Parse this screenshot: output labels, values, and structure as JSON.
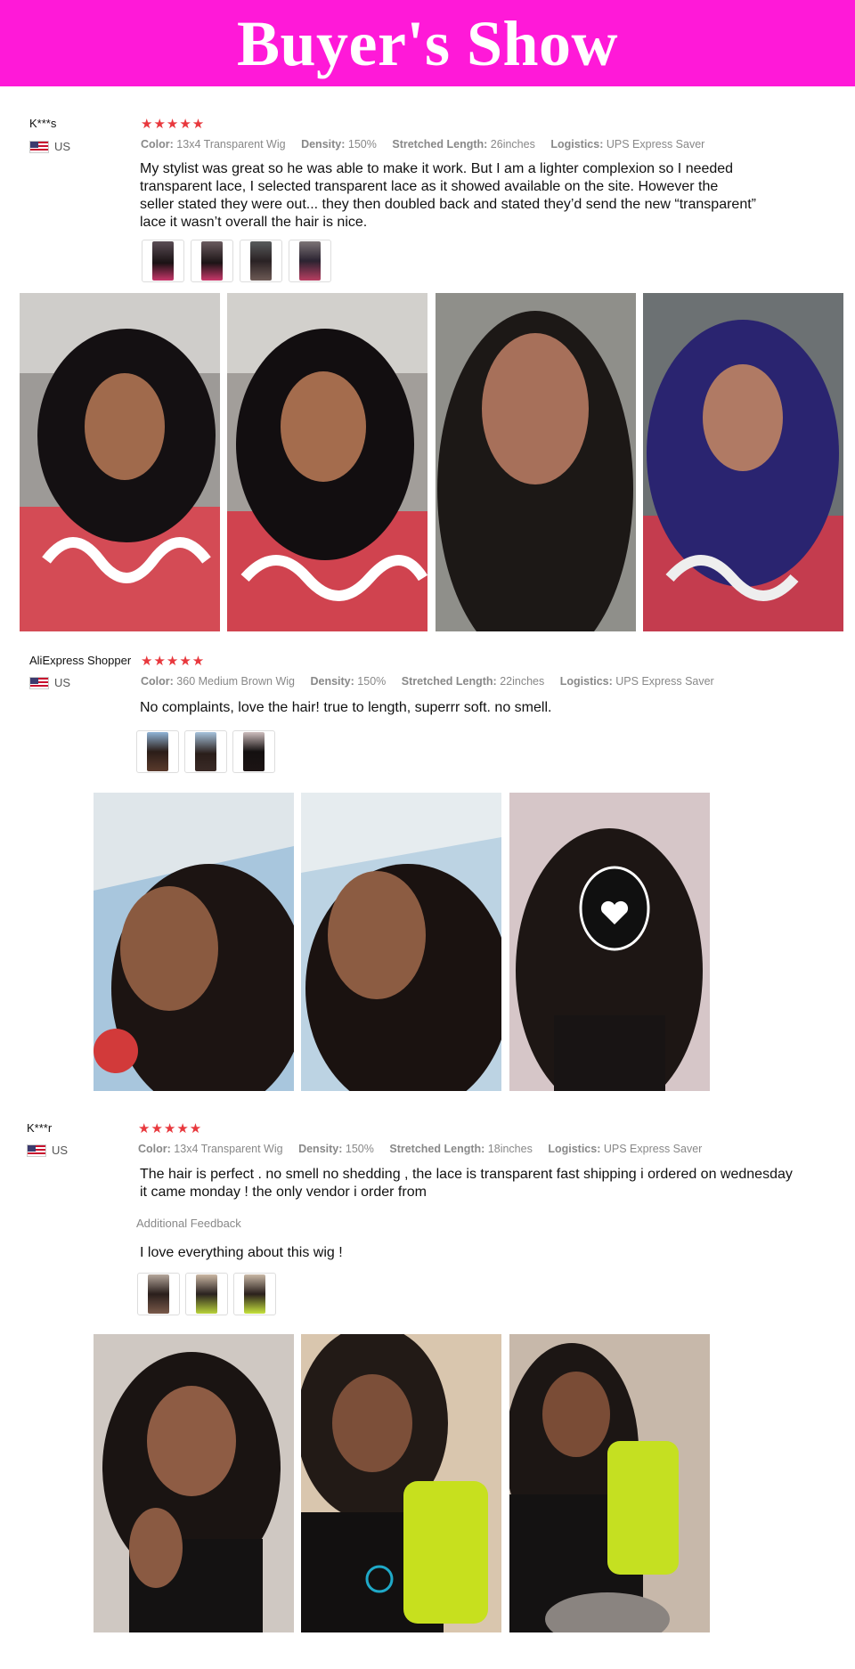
{
  "banner": {
    "title": "Buyer's Show"
  },
  "reviews": [
    {
      "user": "K***s",
      "country": "US",
      "stars": "★★★★★",
      "meta": [
        {
          "label": "Color:",
          "value": "13x4 Transparent Wig"
        },
        {
          "label": "Density:",
          "value": "150%"
        },
        {
          "label": "Stretched Length:",
          "value": "26inches"
        },
        {
          "label": "Logistics:",
          "value": "UPS Express Saver"
        }
      ],
      "text_lines": [
        "My stylist was great so he was able to make it work. But I am a lighter complexion so I needed",
        "transparent lace, I selected transparent lace as it showed available on the site. However the",
        "seller stated they were out... they then doubled back and stated they’d send the new “transparent”",
        "lace it wasn’t overall the hair is nice."
      ]
    },
    {
      "user": "AliExpress Shopper",
      "country": "US",
      "stars": "★★★★★",
      "meta": [
        {
          "label": "Color:",
          "value": "360 Medium Brown Wig"
        },
        {
          "label": "Density:",
          "value": "150%"
        },
        {
          "label": "Stretched Length:",
          "value": "22inches"
        },
        {
          "label": "Logistics:",
          "value": "UPS Express Saver"
        }
      ],
      "text_lines": [
        "No complaints, love the hair! true to length, superrr soft. no smell."
      ]
    },
    {
      "user": "K***r",
      "country": "US",
      "stars": "★★★★★",
      "meta": [
        {
          "label": "Color:",
          "value": "13x4 Transparent Wig"
        },
        {
          "label": "Density:",
          "value": "150%"
        },
        {
          "label": "Stretched Length:",
          "value": "18inches"
        },
        {
          "label": "Logistics:",
          "value": "UPS Express Saver"
        }
      ],
      "text_lines": [
        "The hair is perfect . no smell no shedding , the lace is transparent fast shipping i ordered on wednesday",
        "it came monday ! the only vendor i order from"
      ],
      "additional_label": "Additional Feedback",
      "additional_text": "I love everything about this wig !"
    }
  ],
  "colors": {
    "banner": "#ff19d8",
    "stars": "#e8383d",
    "meta": "#888888"
  }
}
